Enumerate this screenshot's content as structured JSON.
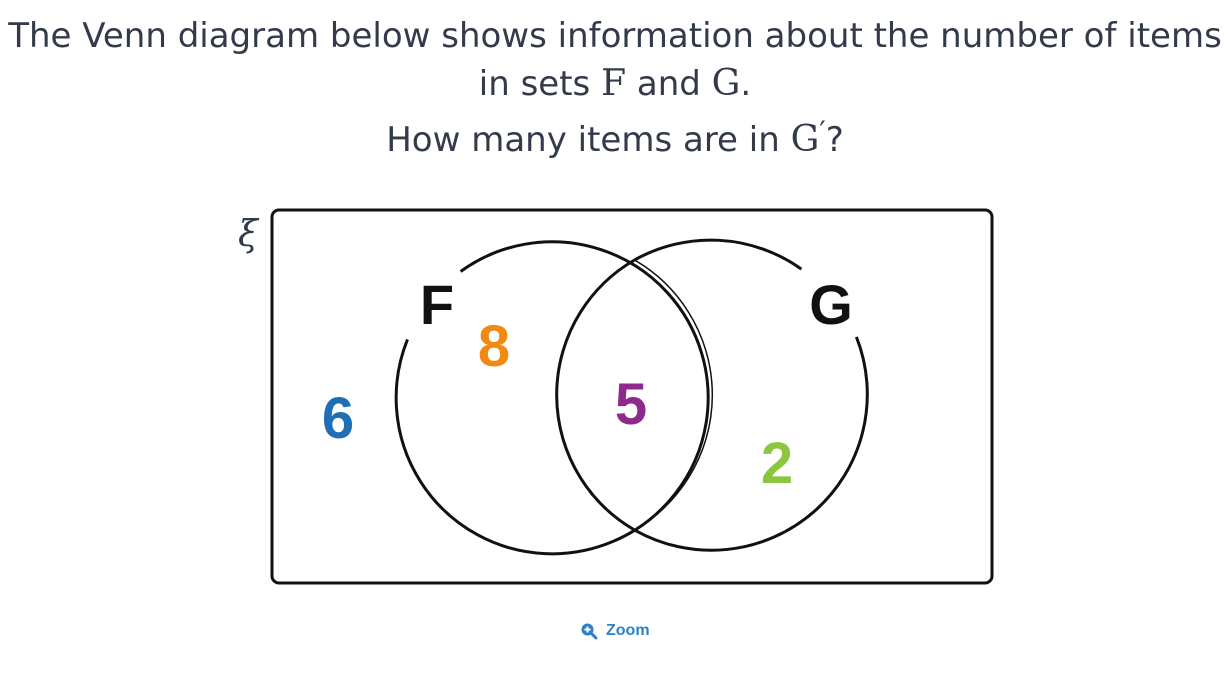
{
  "question": {
    "line1": "The Venn diagram below shows information about the number of items",
    "line2_pre": "in sets ",
    "set_f": "F",
    "line2_mid": " and ",
    "set_g": "G",
    "line2_post": ".",
    "line3_pre": "How many items are in ",
    "complement_set": "G",
    "complement_mark": "′",
    "line3_post": "?"
  },
  "diagram": {
    "universal_symbol": "ξ",
    "label_f": "F",
    "label_g": "G",
    "regions": {
      "outside": "6",
      "f_only": "8",
      "intersection": "5",
      "g_only": "2"
    },
    "colors": {
      "outside": "#1f6fb5",
      "f_only": "#f28a12",
      "intersection": "#8e2a8e",
      "g_only": "#8cc63f",
      "outline": "#111111"
    }
  },
  "zoom": {
    "label": "Zoom",
    "icon": "zoom-in-icon"
  }
}
